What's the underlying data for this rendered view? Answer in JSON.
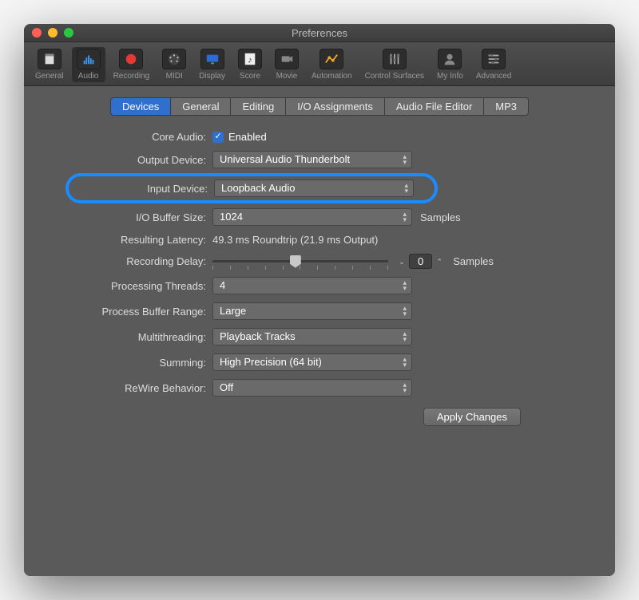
{
  "window": {
    "title": "Preferences"
  },
  "toolbar": {
    "items": [
      {
        "label": "General",
        "icon": "general"
      },
      {
        "label": "Audio",
        "icon": "audio"
      },
      {
        "label": "Recording",
        "icon": "record"
      },
      {
        "label": "MIDI",
        "icon": "midi"
      },
      {
        "label": "Display",
        "icon": "display"
      },
      {
        "label": "Score",
        "icon": "score"
      },
      {
        "label": "Movie",
        "icon": "movie"
      },
      {
        "label": "Automation",
        "icon": "automation"
      },
      {
        "label": "Control Surfaces",
        "icon": "surfaces"
      },
      {
        "label": "My Info",
        "icon": "user"
      },
      {
        "label": "Advanced",
        "icon": "advanced"
      }
    ],
    "selected_index": 1
  },
  "tabs": {
    "items": [
      "Devices",
      "General",
      "Editing",
      "I/O Assignments",
      "Audio File Editor",
      "MP3"
    ],
    "active_index": 0
  },
  "devices": {
    "core_audio_label": "Core Audio:",
    "core_audio_enabled": "Enabled",
    "output_label": "Output Device:",
    "output_value": "Universal Audio Thunderbolt",
    "input_label": "Input Device:",
    "input_value": "Loopback Audio",
    "buffer_label": "I/O Buffer Size:",
    "buffer_value": "1024",
    "buffer_suffix": "Samples",
    "latency_label": "Resulting Latency:",
    "latency_value": "49.3 ms Roundtrip (21.9 ms Output)",
    "delay_label": "Recording Delay:",
    "delay_value": "0",
    "delay_suffix": "Samples",
    "threads_label": "Processing Threads:",
    "threads_value": "4",
    "proc_range_label": "Process Buffer Range:",
    "proc_range_value": "Large",
    "multithread_label": "Multithreading:",
    "multithread_value": "Playback Tracks",
    "summing_label": "Summing:",
    "summing_value": "High Precision (64 bit)",
    "rewire_label": "ReWire Behavior:",
    "rewire_value": "Off",
    "apply_label": "Apply Changes"
  },
  "highlight_row": "input"
}
